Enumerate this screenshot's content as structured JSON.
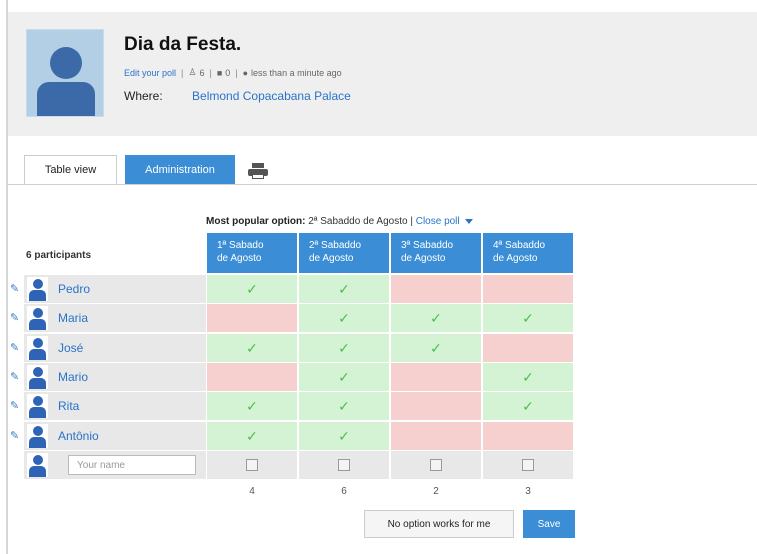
{
  "poll": {
    "title": "Dia da Festa.",
    "edit_link": "Edit your poll",
    "participant_count": "6",
    "comment_count": "0",
    "time_ago": "less than a minute ago",
    "where_label": "Where:",
    "where_value": "Belmond Copacabana Palace"
  },
  "tabs": {
    "table_view": "Table view",
    "administration": "Administration"
  },
  "summary": {
    "most_popular_label": "Most popular option:",
    "most_popular_value": "2ª Sabaddo de Agosto |",
    "close_poll": "Close poll"
  },
  "participants_label": "6 participants",
  "columns": [
    {
      "line1": "1ª Sabado",
      "line2": "de Agosto"
    },
    {
      "line1": "2ª Sabaddo",
      "line2": "de Agosto"
    },
    {
      "line1": "3ª Sabaddo",
      "line2": "de Agosto"
    },
    {
      "line1": "4ª Sabaddo",
      "line2": "de Agosto"
    }
  ],
  "rows": [
    {
      "name": "Pedro",
      "votes": [
        true,
        true,
        false,
        false
      ]
    },
    {
      "name": "Maria",
      "votes": [
        false,
        true,
        true,
        true
      ]
    },
    {
      "name": "José",
      "votes": [
        true,
        true,
        true,
        false
      ]
    },
    {
      "name": "Mario",
      "votes": [
        false,
        true,
        false,
        true
      ]
    },
    {
      "name": "Rita",
      "votes": [
        true,
        true,
        false,
        true
      ]
    },
    {
      "name": "Antônio",
      "votes": [
        true,
        true,
        false,
        false
      ]
    }
  ],
  "new_entry": {
    "placeholder": "Your name"
  },
  "totals": [
    "4",
    "6",
    "2",
    "3"
  ],
  "buttons": {
    "no_option": "No option works for me",
    "save": "Save"
  },
  "colors": {
    "accent": "#3b8ed6",
    "link": "#2a73c9",
    "yes_cell": "#d4f2d4",
    "no_cell": "#f6cfcf",
    "checkmark": "#4cbf4c"
  },
  "icons": {
    "user_count": "user-icon",
    "comment_count": "comment-icon",
    "time": "clock-icon",
    "edit_participant": "pencil-icon",
    "print": "printer-icon"
  }
}
